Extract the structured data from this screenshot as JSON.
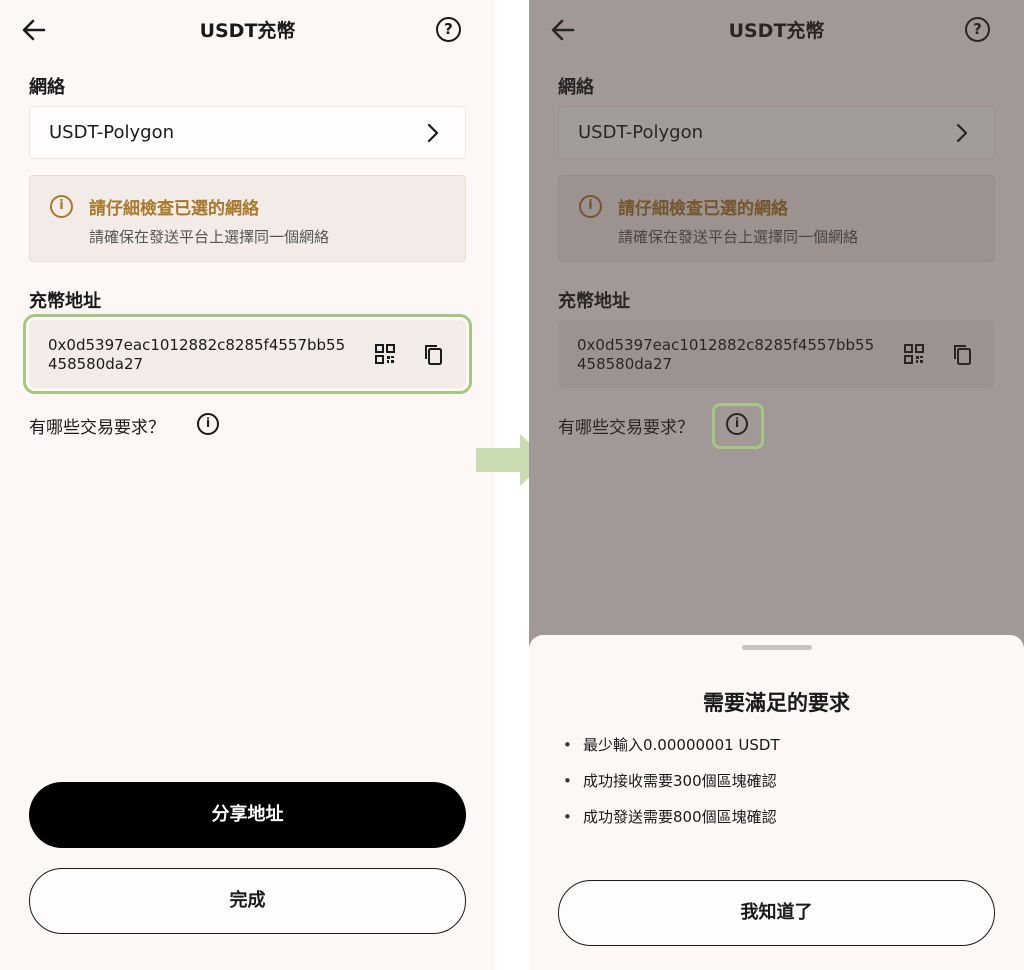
{
  "left": {
    "header": {
      "title": "USDT充幣",
      "help_glyph": "?"
    },
    "network": {
      "label": "網絡",
      "value": "USDT-Polygon"
    },
    "warning": {
      "icon_glyph": "i",
      "title": "請仔細檢查已選的網絡",
      "subtitle": "請確保在發送平台上選擇同一個網絡"
    },
    "address": {
      "label": "充幣地址",
      "value": "0x0d5397eac1012882c8285f4557bb55458580da27"
    },
    "requirements": {
      "text": "有哪些交易要求？",
      "icon_glyph": "i"
    },
    "share_button": "分享地址",
    "done_button": "完成"
  },
  "right": {
    "header": {
      "title": "USDT充幣",
      "help_glyph": "?"
    },
    "network": {
      "label": "網絡",
      "value": "USDT-Polygon"
    },
    "warning": {
      "icon_glyph": "i",
      "title": "請仔細檢查已選的網絡",
      "subtitle": "請確保在發送平台上選擇同一個網絡"
    },
    "address": {
      "label": "充幣地址",
      "value": "0x0d5397eac1012882c8285f4557bb55458580da27"
    },
    "requirements": {
      "text": "有哪些交易要求？",
      "icon_glyph": "i"
    },
    "sheet": {
      "title": "需要滿足的要求",
      "items": [
        "最少輸入0.00000001 USDT",
        "成功接收需要300個區塊確認",
        "成功發送需要800個區塊確認"
      ],
      "ok_button": "我知道了"
    }
  },
  "colors": {
    "accent_warning": "#a8782a",
    "highlight": "#a5c880",
    "background": "#fdf8f6"
  },
  "icons": [
    "back-arrow-icon",
    "help-icon",
    "chevron-right-icon",
    "info-icon",
    "qr-code-icon",
    "copy-icon",
    "step-arrow-icon"
  ]
}
